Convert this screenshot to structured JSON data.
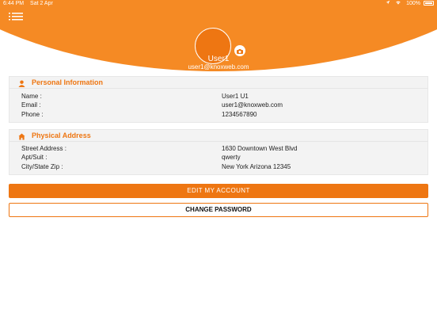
{
  "status_bar": {
    "time": "6:44 PM",
    "date": "Sat 2 Apr",
    "battery": "100%"
  },
  "colors": {
    "accent": "#ee7612",
    "header": "#f58a24"
  },
  "profile": {
    "name": "User1",
    "email": "user1@knoxweb.com"
  },
  "personal_info": {
    "title": "Personal Information",
    "rows": [
      {
        "label": "Name :",
        "value": "User1 U1"
      },
      {
        "label": "Email :",
        "value": "user1@knoxweb.com"
      },
      {
        "label": "Phone :",
        "value": "1234567890"
      }
    ]
  },
  "physical_address": {
    "title": "Physical Address",
    "rows": [
      {
        "label": "Street Address :",
        "value": "1630 Downtown West Blvd"
      },
      {
        "label": "Apt/Suit :",
        "value": "qwerty"
      },
      {
        "label": "City/State Zip :",
        "value": "New York Arizona 12345"
      }
    ]
  },
  "actions": {
    "edit_label": "EDIT MY ACCOUNT",
    "change_password_label": "CHANGE PASSWORD"
  },
  "icons": {
    "menu": "menu-icon",
    "camera": "camera-icon",
    "person": "person-icon",
    "home": "home-icon",
    "wifi": "wifi-icon",
    "battery": "battery-icon"
  }
}
